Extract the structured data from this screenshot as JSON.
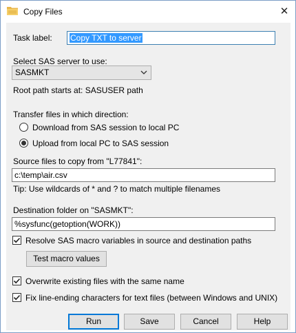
{
  "window": {
    "title": "Copy Files",
    "close_glyph": "✕"
  },
  "task": {
    "label": "Task label:",
    "value": "Copy TXT to server"
  },
  "server": {
    "label": "Select SAS server to use:",
    "selected": "SASMKT",
    "root_text": "Root path starts at: SASUSER path"
  },
  "direction": {
    "label": "Transfer files in which direction:",
    "options": [
      {
        "label": "Download from SAS session to local PC",
        "checked": false
      },
      {
        "label": "Upload from local PC to SAS session",
        "checked": true
      }
    ]
  },
  "source": {
    "label": "Source files to copy from \"L77841\":",
    "value": "c:\\temp\\air.csv",
    "tip": "Tip: Use wildcards of * and ? to match multiple filenames"
  },
  "destination": {
    "label": "Destination folder on \"SASMKT\":",
    "value": "%sysfunc(getoption(WORK))"
  },
  "options": {
    "resolve_macro": "Resolve SAS macro variables in source and destination paths",
    "test_macro": "Test macro values",
    "overwrite": "Overwrite existing files with the same name",
    "fix_line_endings": "Fix line-ending characters for text files (between Windows and UNIX)"
  },
  "buttons": {
    "run": "Run",
    "save": "Save",
    "cancel": "Cancel",
    "help": "Help"
  },
  "colors": {
    "selection": "#3399ff",
    "accent": "#0078d7",
    "dialog_bg": "#f0f0f0"
  },
  "icons": {
    "app": "folder-icon",
    "close": "close-icon",
    "dropdown": "chevron-down-icon",
    "check": "checkmark-icon"
  }
}
